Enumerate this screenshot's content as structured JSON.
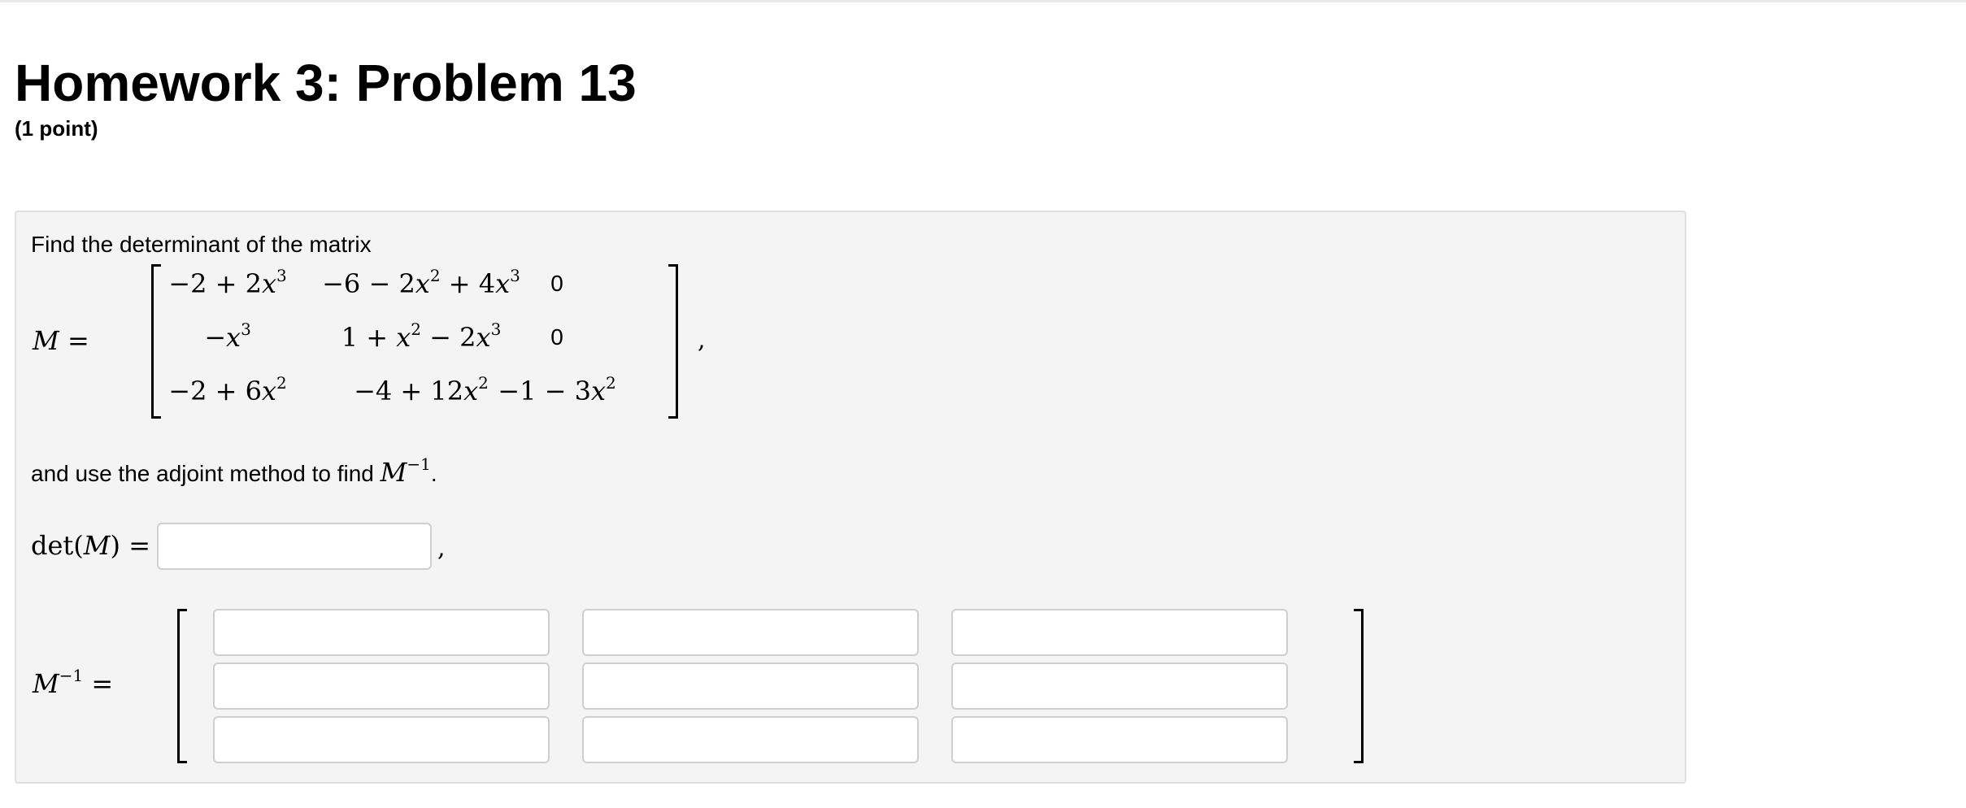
{
  "header": {
    "title": "Homework 3: Problem 13",
    "points": "(1 point)"
  },
  "problem": {
    "intro_text": "Find the determinant of the matrix",
    "matrix_label": "M =",
    "matrix": [
      [
        "−2 + 2x³",
        "−6 − 2x² + 4x³",
        "0"
      ],
      [
        "−x³",
        "1 + x² − 2x³",
        "0"
      ],
      [
        "−2 + 6x²",
        "−4 + 12x²",
        "−1 − 3x²"
      ]
    ],
    "matrix_trailing_comma": ",",
    "instruction_text": "and use the adjoint method to find",
    "instruction_math": "M",
    "instruction_sup": "−1",
    "instruction_period": "."
  },
  "answers": {
    "det_label": "det(M) =",
    "det_value": "",
    "det_trailing_comma": ",",
    "inverse_label": "M",
    "inverse_sup": "−1",
    "inverse_equals": "=",
    "inverse_values": [
      [
        "",
        "",
        ""
      ],
      [
        "",
        "",
        ""
      ],
      [
        "",
        "",
        ""
      ]
    ]
  }
}
